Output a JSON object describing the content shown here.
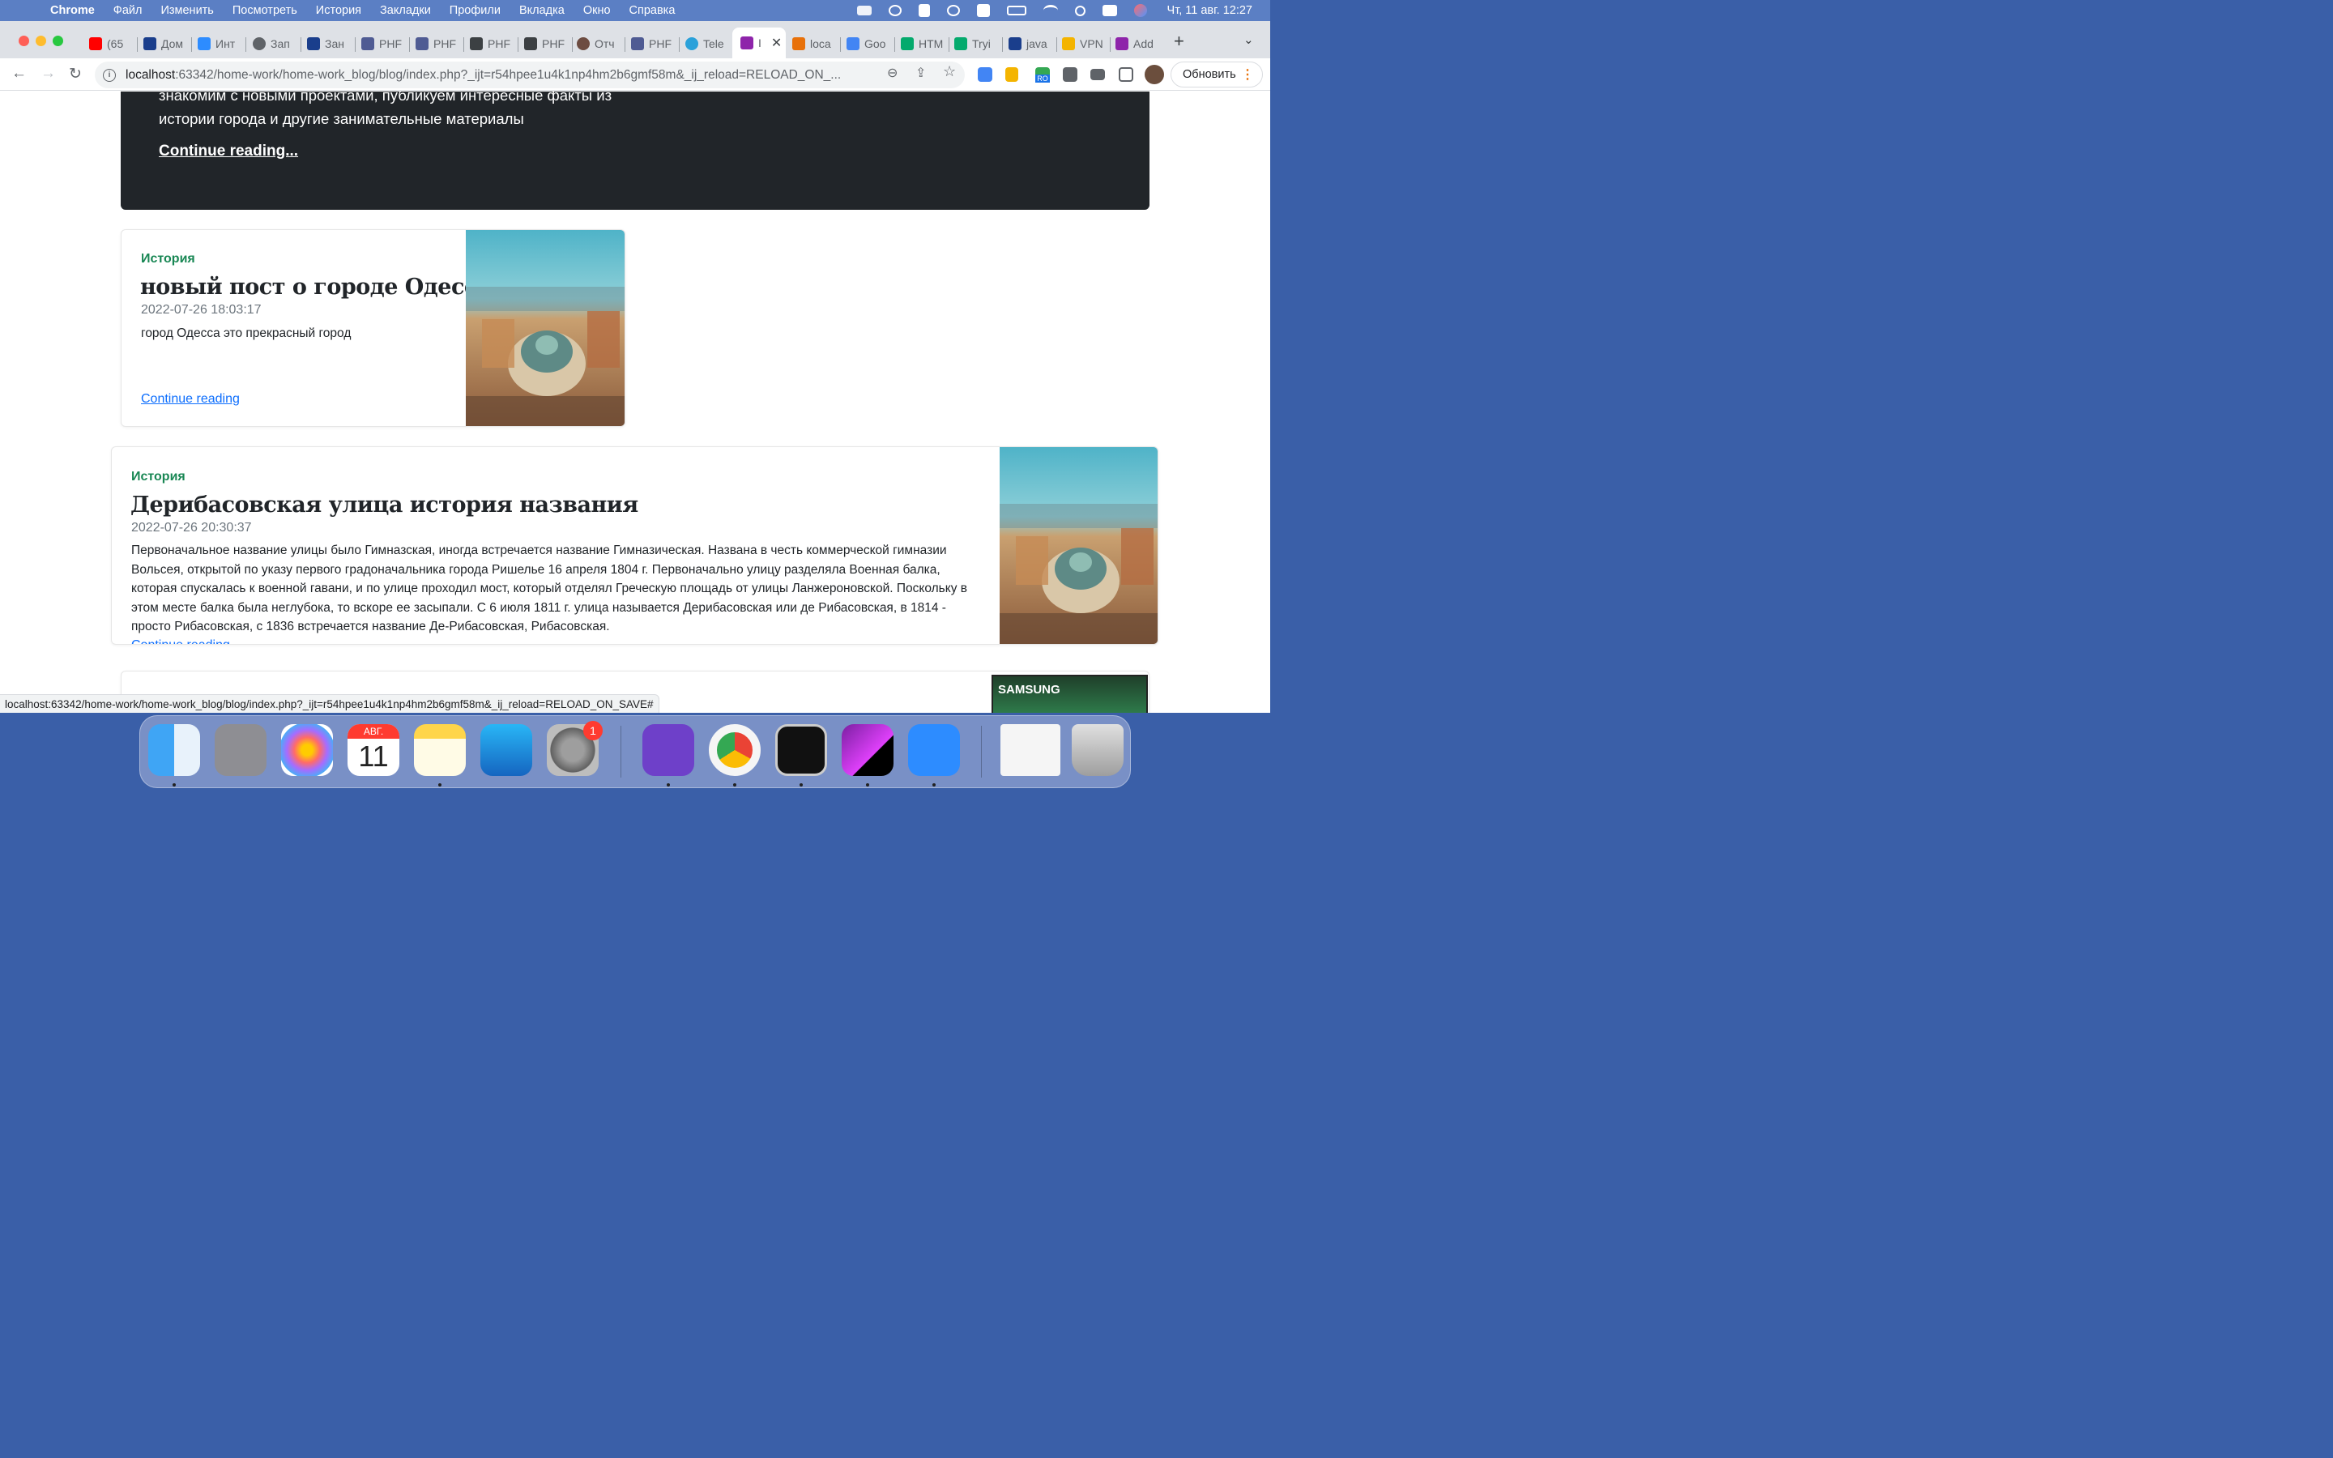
{
  "menubar": {
    "app": "Chrome",
    "items": [
      "Файл",
      "Изменить",
      "Посмотреть",
      "История",
      "Закладки",
      "Профили",
      "Вкладка",
      "Окно",
      "Справка"
    ],
    "clock": "Чт, 11 авг.  12:27"
  },
  "tabs": [
    {
      "label": "(65",
      "color": "#ff0000"
    },
    {
      "label": "Дом",
      "color": "#1a3e8c"
    },
    {
      "label": "Инт",
      "color": "#2d8cff"
    },
    {
      "label": "Зап",
      "color": "#5f6368"
    },
    {
      "label": "Зан",
      "color": "#1a3e8c"
    },
    {
      "label": "PHF",
      "color": "#4f5b93"
    },
    {
      "label": "PHF",
      "color": "#4f5b93"
    },
    {
      "label": "PHF",
      "color": "#3c4043"
    },
    {
      "label": "PHF",
      "color": "#3c4043"
    },
    {
      "label": "Отч",
      "color": "#6d4c41"
    },
    {
      "label": "PHF",
      "color": "#4f5b93"
    },
    {
      "label": "Tele",
      "color": "#2aa1da"
    },
    {
      "label": "I",
      "color": "#8e24aa"
    },
    {
      "label": "loca",
      "color": "#e8710a"
    },
    {
      "label": "Goo",
      "color": "#4285f4"
    },
    {
      "label": "HTM",
      "color": "#04aa6d"
    },
    {
      "label": "Tryi",
      "color": "#04aa6d"
    },
    {
      "label": "java",
      "color": "#1a3e8c"
    },
    {
      "label": "VPN",
      "color": "#f4b400"
    },
    {
      "label": "Add",
      "color": "#8e24aa"
    }
  ],
  "omnibox": {
    "url_host": "localhost",
    "url_rest": ":63342/home-work/home-work_blog/blog/index.php?_ijt=r54hpee1u4k1np4hm2b6gmf58m&_ij_reload=RELOAD_ON_..."
  },
  "toolbar": {
    "update_label": "Обновить",
    "ext_badge": "RO"
  },
  "jumbotron": {
    "lead_line1": "знакомим с новыми проектами, публикуем интересные факты из",
    "lead_line2": "истории города и другие занимательные материалы",
    "continue": "Continue reading..."
  },
  "posts": [
    {
      "category": "История",
      "title": "новый пост о городе Одесса",
      "date": "2022-07-26 18:03:17",
      "body": "город Одесса это прекрасный город",
      "link": "Continue reading"
    },
    {
      "category": "История",
      "title": "Дерибасовская улица история названия",
      "date": "2022-07-26 20:30:37",
      "body": "Первоначальное название улицы было Гимназская, иногда встречается название Гимназическая. Названа в честь коммерческой гимназии Вольсея, открытой по указу первого градоначальника города Ришелье 16 апреля 1804 г. Первоначально улицу разделяла Военная балка, которая спускалась к военной гавани, и по улице проходил мост, который отделял Греческую площадь от улицы Ланжероновской. Поскольку в этом месте балка была неглубока, то вскоре ее засыпали. С 6 июля 1811 г. улица называется Дерибасовская или де Рибасовская, в 1814 - просто Рибасовская, с 1836 встречается название Де-Рибасовская, Рибасовская.",
      "link": "Continue reading"
    }
  ],
  "third_card_image_label": "SAMSUNG",
  "statusbar": "localhost:63342/home-work/home-work_blog/blog/index.php?_ijt=r54hpee1u4k1np4hm2b6gmf58m&_ij_reload=RELOAD_ON_SAVE#",
  "dock": {
    "calendar_month": "АВГ.",
    "calendar_day": "11",
    "settings_badge": "1"
  }
}
